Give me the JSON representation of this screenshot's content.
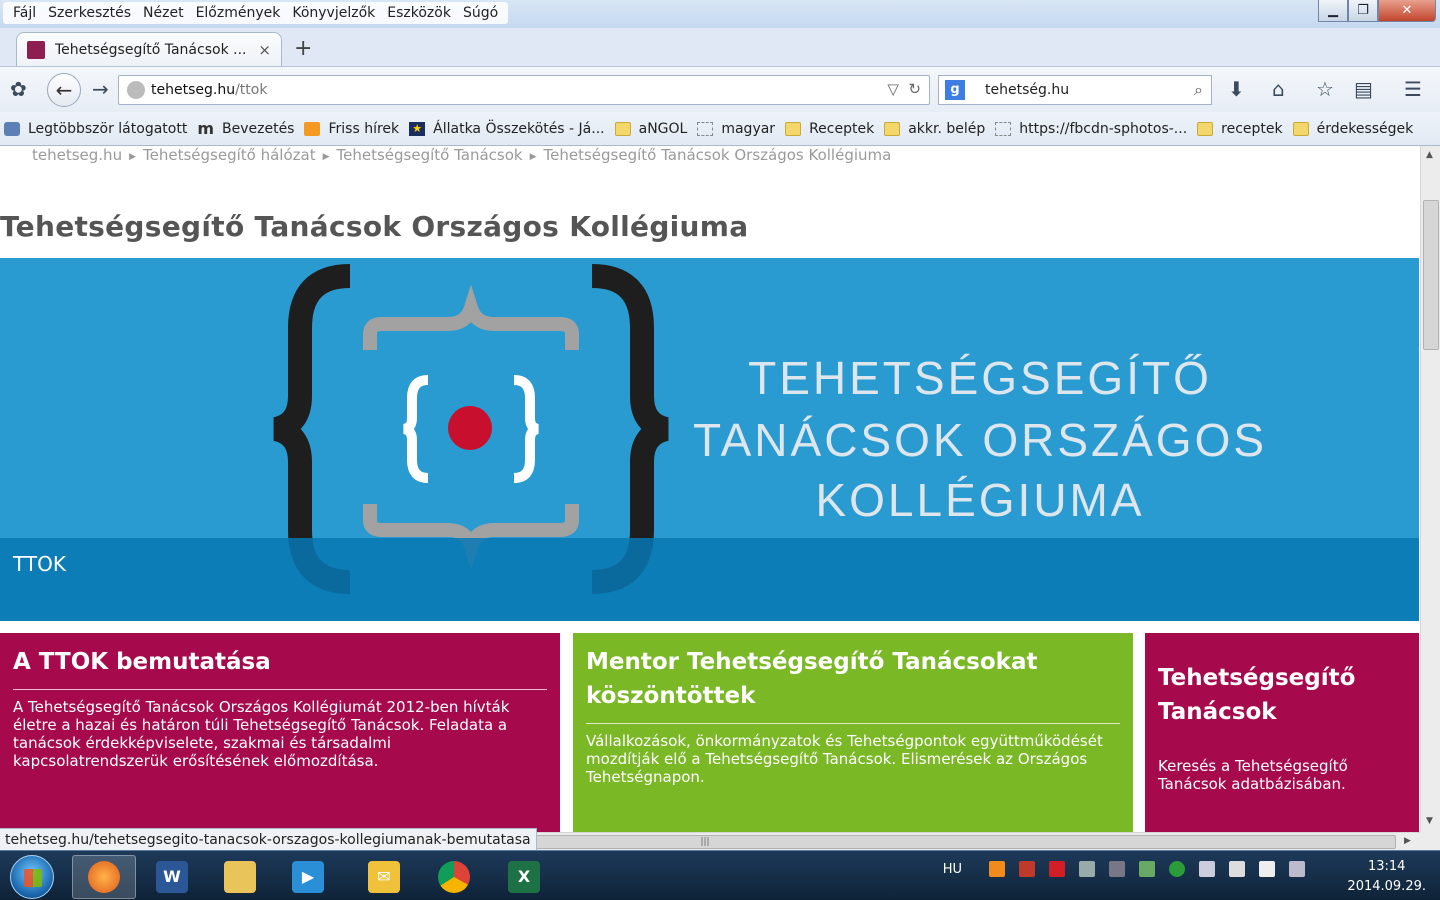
{
  "menu": [
    "Fájl",
    "Szerkesztés",
    "Nézet",
    "Előzmények",
    "Könyvjelzők",
    "Eszközök",
    "Súgó"
  ],
  "tab": {
    "title": "Tehetségsegítő Tanácsok ...",
    "close": "×",
    "new_tab": "+"
  },
  "url": {
    "host": "tehetseg.hu",
    "path": "/ttok"
  },
  "search": {
    "engine": "g",
    "value": "tehetség.hu"
  },
  "bookmarks": [
    {
      "label": "Legtöbbször látogatott",
      "icon": "most-visited-icon"
    },
    {
      "label": "Bevezetés",
      "icon": "m-icon"
    },
    {
      "label": "Friss hírek",
      "icon": "rss-icon"
    },
    {
      "label": "Állatka Összekötés - Já...",
      "icon": "star-icon"
    },
    {
      "label": "aNGOL",
      "icon": "folder-icon"
    },
    {
      "label": "magyar",
      "icon": "blank-page-icon"
    },
    {
      "label": "Receptek",
      "icon": "folder-icon"
    },
    {
      "label": "akkr. belép",
      "icon": "folder-icon"
    },
    {
      "label": "https://fbcdn-sphotos-...",
      "icon": "blank-page-icon"
    },
    {
      "label": "receptek",
      "icon": "folder-icon"
    },
    {
      "label": "érdekességek",
      "icon": "folder-icon"
    }
  ],
  "breadcrumb": [
    "tehetseg.hu",
    "Tehetségsegítő hálózat",
    "Tehetségsegítő Tanácsok",
    "Tehetségsegítő Tanácsok Országos Kollégiuma"
  ],
  "page_title": "Tehetségsegítő Tanácsok Országos Kollégiuma",
  "banner": {
    "logo_line1": "TEHETSÉGSEGÍTŐ",
    "logo_line2": "TANÁCSOK ORSZÁGOS",
    "logo_line3": "KOLLÉGIUMA",
    "caption": "TTOK",
    "bg_color": "#2a9bd0"
  },
  "cards": [
    {
      "title": "A TTOK bemutatása",
      "text": "A Tehetségsegítő Tanácsok Országos Kollégiumát 2012-ben hívták életre a hazai és határon túli Tehetségsegítő Tanácsok. Feladata a tanácsok érdekképviselete, szakmai és társadalmi kapcsolatrendszerük erősítésének előmozdítása.",
      "color": "#a60a4d"
    },
    {
      "title": "Mentor Tehetségsegítő Tanácsokat köszöntöttek",
      "text": "Vállalkozások, önkormányzatok és Tehetségpontok együttműködését mozdítják elő a Tehetségsegítő Tanácsok. Elismerések az Országos Tehetségnapon.",
      "color": "#7ab826"
    },
    {
      "title": "Tehetségsegítő Tanácsok",
      "text": "Keresés a Tehetségsegítő Tanácsok adatbázisában.",
      "color": "#a60a4d"
    }
  ],
  "status_url": "tehetseg.hu/tehetsegsegito-tanacsok-orszagos-kollegiumanak-bemutatasa",
  "taskbar": {
    "apps": [
      "firefox-icon",
      "word-icon",
      "explorer-icon",
      "media-player-icon",
      "messenger-icon",
      "chrome-icon",
      "excel-icon"
    ],
    "lang": "HU",
    "time": "13:14",
    "date": "2014.09.29."
  }
}
